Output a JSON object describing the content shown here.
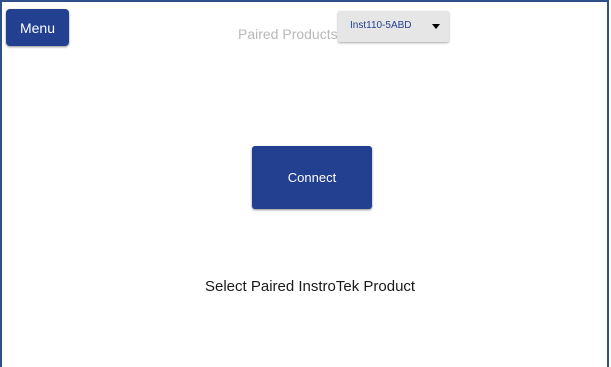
{
  "header": {
    "menu_label": "Menu",
    "paired_products_label": "Paired Products",
    "selected_product": "Inst110-5ABD",
    "dropdown_icon": "caret-down-icon"
  },
  "main": {
    "connect_label": "Connect",
    "status_message": "Select Paired InstroTek Product"
  },
  "colors": {
    "primary": "#233f8f",
    "border": "#2f4f88",
    "muted_label": "#b8b8b8",
    "dropdown_bg": "#e6e6e6"
  }
}
